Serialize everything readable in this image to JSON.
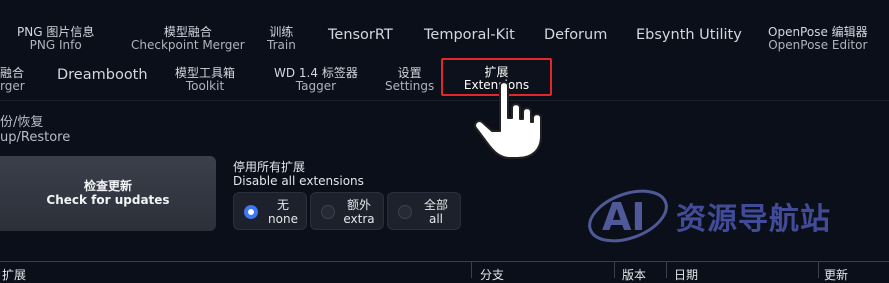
{
  "tabs_row1": [
    {
      "zh": "PNG 图片信息",
      "en": "PNG Info"
    },
    {
      "zh": "模型融合",
      "en": "Checkpoint Merger"
    },
    {
      "zh": "训练",
      "en": "Train"
    },
    {
      "single": "TensorRT"
    },
    {
      "single": "Temporal-Kit"
    },
    {
      "single": "Deforum"
    },
    {
      "single": "Ebsynth Utility"
    },
    {
      "zh": "OpenPose 编辑器",
      "en": "OpenPose Editor"
    }
  ],
  "tabs_row2": [
    {
      "zh": "融合",
      "en": "rger"
    },
    {
      "single": "Dreambooth"
    },
    {
      "zh": "模型工具箱",
      "en": "Toolkit"
    },
    {
      "zh": "WD 1.4 标签器",
      "en": "Tagger"
    },
    {
      "zh": "设置",
      "en": "Settings"
    },
    {
      "zh": "扩展",
      "en": "Extensions",
      "selected": true
    }
  ],
  "subtab": {
    "zh": "份/恢复",
    "en": "up/Restore"
  },
  "check_updates": {
    "zh": "检查更新",
    "en": "Check for updates"
  },
  "disable_all": {
    "zh": "停用所有扩展",
    "en": "Disable all extensions",
    "options": [
      {
        "zh": "无",
        "en": "none",
        "checked": true
      },
      {
        "zh": "额外",
        "en": "extra",
        "checked": false
      },
      {
        "zh": "全部",
        "en": "all",
        "checked": false
      }
    ]
  },
  "table_headers": [
    "扩展",
    "分支",
    "版本",
    "日期",
    "更新"
  ],
  "watermark": {
    "logo": "AI",
    "text": "资源导航站"
  },
  "colors": {
    "background": "#0b0f19",
    "selected_border": "#e3262a",
    "radio_accent": "#3b78f2",
    "watermark": "#6f7cff"
  },
  "cursor": "hand-pointer-icon"
}
